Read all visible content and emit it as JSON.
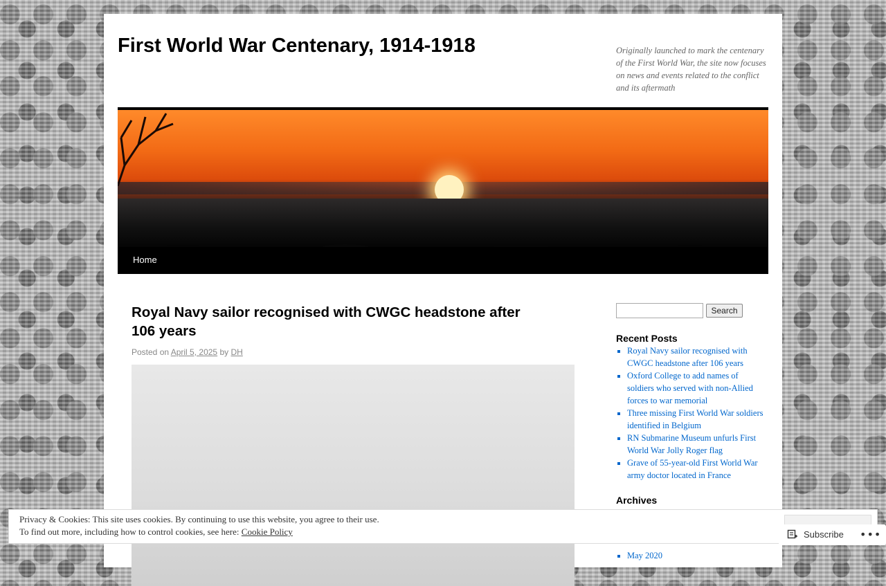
{
  "site": {
    "title": "First World War Centenary, 1914-1918",
    "description": "Originally launched to mark the centenary of the First World War, the site now focuses on news and events related to the conflict and its aftermath"
  },
  "nav": {
    "items": [
      {
        "label": "Home"
      }
    ]
  },
  "post": {
    "title": "Royal Navy sailor recognised with CWGC headstone after 106 years",
    "posted_on": "Posted on",
    "date": "April 5, 2025",
    "by": "by",
    "author": "DH"
  },
  "sidebar": {
    "search_button": "Search",
    "search_placeholder": "",
    "recent_posts_title": "Recent Posts",
    "recent_posts": [
      "Royal Navy sailor recognised with CWGC headstone after 106 years",
      "Oxford College to add names of soldiers who served with non-Allied forces to war memorial",
      "Three missing First World War soldiers identified in Belgium",
      "RN Submarine Museum unfurls First World War Jolly Roger flag",
      "Grave of 55-year-old First World War army doctor located in France"
    ],
    "archives_title": "Archives",
    "archives": [
      "May 2020"
    ]
  },
  "cookie": {
    "line1": "Privacy & Cookies: This site uses cookies. By continuing to use this website, you agree to their use.",
    "line2": "To find out more, including how to control cookies, see here:",
    "link": "Cookie Policy"
  },
  "subscribe": {
    "label": "Subscribe"
  },
  "colors": {
    "link": "#0066cc",
    "nav_bg": "#000000",
    "page_bg": "#ffffff"
  }
}
